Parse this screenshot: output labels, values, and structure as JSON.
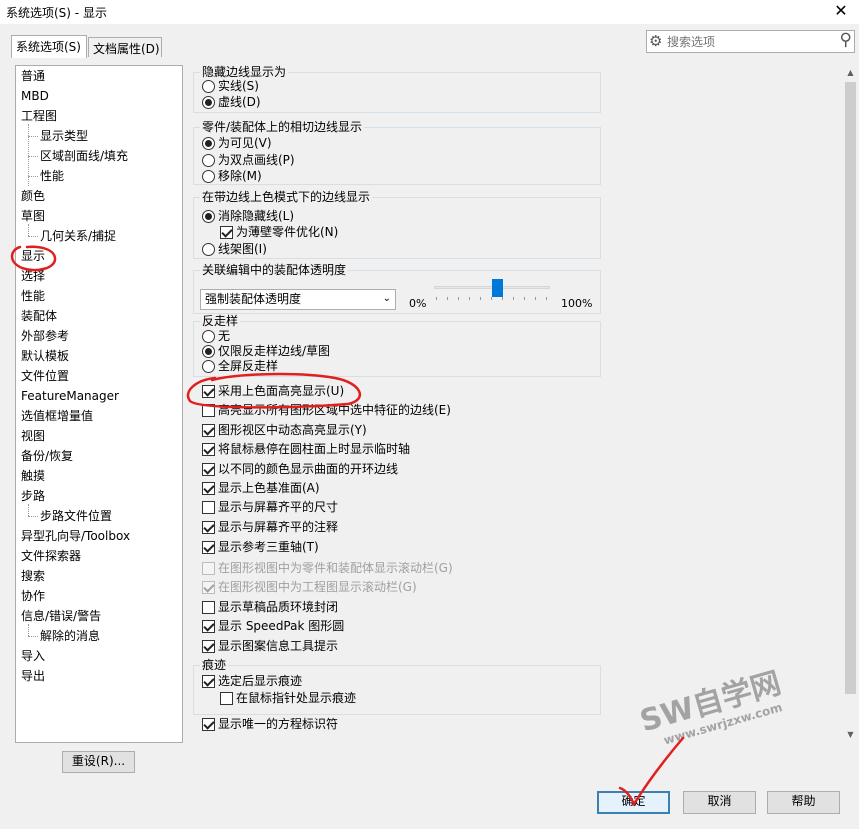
{
  "window": {
    "title": "系统选项(S) - 显示",
    "close_icon": "✕"
  },
  "tabs": [
    {
      "label": "系统选项(S)",
      "active": true
    },
    {
      "label": "文档属性(D)",
      "active": false
    }
  ],
  "search": {
    "placeholder": "搜索选项"
  },
  "tree": {
    "items": [
      {
        "label": "普通",
        "level": 0
      },
      {
        "label": "MBD",
        "level": 0
      },
      {
        "label": "工程图",
        "level": 0
      },
      {
        "label": "显示类型",
        "level": 1
      },
      {
        "label": "区域剖面线/填充",
        "level": 1
      },
      {
        "label": "性能",
        "level": 1
      },
      {
        "label": "颜色",
        "level": 0
      },
      {
        "label": "草图",
        "level": 0
      },
      {
        "label": "几何关系/捕捉",
        "level": 1
      },
      {
        "label": "显示",
        "level": 0,
        "selected": true
      },
      {
        "label": "选择",
        "level": 0
      },
      {
        "label": "性能",
        "level": 0
      },
      {
        "label": "装配体",
        "level": 0
      },
      {
        "label": "外部参考",
        "level": 0
      },
      {
        "label": "默认模板",
        "level": 0
      },
      {
        "label": "文件位置",
        "level": 0
      },
      {
        "label": "FeatureManager",
        "level": 0
      },
      {
        "label": "选值框增量值",
        "level": 0
      },
      {
        "label": "视图",
        "level": 0
      },
      {
        "label": "备份/恢复",
        "level": 0
      },
      {
        "label": "触摸",
        "level": 0
      },
      {
        "label": "步路",
        "level": 0
      },
      {
        "label": "步路文件位置",
        "level": 1
      },
      {
        "label": "异型孔向导/Toolbox",
        "level": 0
      },
      {
        "label": "文件探索器",
        "level": 0
      },
      {
        "label": "搜索",
        "level": 0
      },
      {
        "label": "协作",
        "level": 0
      },
      {
        "label": "信息/错误/警告",
        "level": 0
      },
      {
        "label": "解除的消息",
        "level": 1
      },
      {
        "label": "导入",
        "level": 0
      },
      {
        "label": "导出",
        "level": 0
      }
    ]
  },
  "groups": {
    "hidden_edges": {
      "title": "隐藏边线显示为",
      "options": [
        {
          "label": "实线(S)",
          "checked": false
        },
        {
          "label": "虚线(D)",
          "checked": true
        }
      ]
    },
    "tangent_edges": {
      "title": "零件/装配体上的相切边线显示",
      "options": [
        {
          "label": "为可见(V)",
          "checked": true
        },
        {
          "label": "为双点画线(P)",
          "checked": false
        },
        {
          "label": "移除(M)",
          "checked": false
        }
      ]
    },
    "shaded_edges": {
      "title": "在带边线上色模式下的边线显示",
      "options": [
        {
          "label": "消除隐藏线(L)",
          "checked": true
        },
        {
          "label": "线架图(I)",
          "checked": false
        }
      ],
      "sub_checkbox": {
        "label": "为薄壁零件优化(N)",
        "checked": true
      }
    },
    "transparency": {
      "title": "关联编辑中的装配体透明度",
      "dropdown_value": "强制装配体透明度",
      "slider_min_label": "0%",
      "slider_max_label": "100%",
      "slider_value": 0.55
    },
    "antialias": {
      "title": "反走样",
      "options": [
        {
          "label": "无",
          "checked": false
        },
        {
          "label": "仅限反走样边线/草图",
          "checked": true
        },
        {
          "label": "全屏反走样",
          "checked": false
        }
      ]
    },
    "trail": {
      "title": "痕迹",
      "items": [
        {
          "label": "选定后显示痕迹",
          "checked": true
        },
        {
          "label": "在鼠标指针处显示痕迹",
          "checked": false
        }
      ]
    }
  },
  "checkboxes": [
    {
      "label": "采用上色面高亮显示(U)",
      "checked": true,
      "disabled": false
    },
    {
      "label": "高亮显示所有图形区域中选中特征的边线(E)",
      "checked": false,
      "disabled": false
    },
    {
      "label": "图形视区中动态高亮显示(Y)",
      "checked": true,
      "disabled": false
    },
    {
      "label": "将鼠标悬停在圆柱面上时显示临时轴",
      "checked": true,
      "disabled": false
    },
    {
      "label": "以不同的颜色显示曲面的开环边线",
      "checked": true,
      "disabled": false
    },
    {
      "label": "显示上色基准面(A)",
      "checked": true,
      "disabled": false
    },
    {
      "label": "显示与屏幕齐平的尺寸",
      "checked": false,
      "disabled": false
    },
    {
      "label": "显示与屏幕齐平的注释",
      "checked": true,
      "disabled": false
    },
    {
      "label": "显示参考三重轴(T)",
      "checked": true,
      "disabled": false
    },
    {
      "label": "在图形视图中为零件和装配体显示滚动栏(G)",
      "checked": false,
      "disabled": true
    },
    {
      "label": "在图形视图中为工程图显示滚动栏(G)",
      "checked": true,
      "disabled": true
    },
    {
      "label": "显示草稿品质环境封闭",
      "checked": false,
      "disabled": false
    },
    {
      "label": "显示 SpeedPak 图形圆",
      "checked": true,
      "disabled": false
    },
    {
      "label": "显示图案信息工具提示",
      "checked": true,
      "disabled": false
    }
  ],
  "unique_ids_checkbox": {
    "label": "显示唯一的方程标识符",
    "checked": true
  },
  "buttons": {
    "reset": "重设(R)...",
    "ok": "确定",
    "cancel": "取消",
    "help": "帮助"
  },
  "watermark": {
    "main": "SW自学网",
    "url": "www.swrjzxw.com"
  },
  "annotation_color": "#e0201e"
}
